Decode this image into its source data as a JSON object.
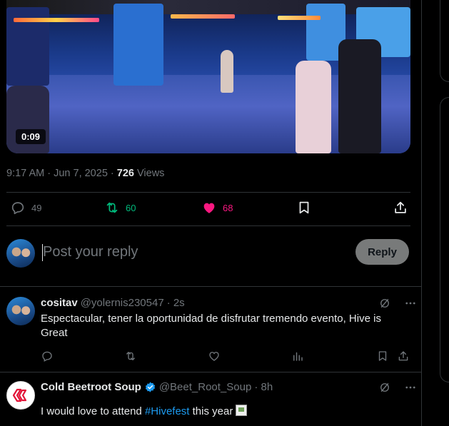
{
  "video": {
    "duration": "0:09"
  },
  "post_meta": {
    "time": "9:17 AM",
    "separator": " · ",
    "date": "Jun 7, 2025",
    "views_count": "726",
    "views_label": " Views"
  },
  "actions": {
    "replies": "49",
    "reposts": "60",
    "likes": "68"
  },
  "reply_composer": {
    "placeholder": "Post your reply",
    "button": "Reply"
  },
  "comments": [
    {
      "name": "cositav",
      "handle": "@yolernis230547",
      "time": "· 2s",
      "text": "Espectacular, tener la oportunidad de disfrutar tremendo evento, Hive is Great"
    },
    {
      "name": "Cold Beetroot Soup",
      "handle": "@Beet_Root_Soup",
      "time": "· 8h",
      "text_before": "I would love to attend ",
      "hashtag": "#Hivefest",
      "text_after": " this year"
    }
  ],
  "colors": {
    "repost": "#00ba7c",
    "like": "#f91880",
    "link": "#1d9bf0",
    "muted": "#71767b"
  }
}
